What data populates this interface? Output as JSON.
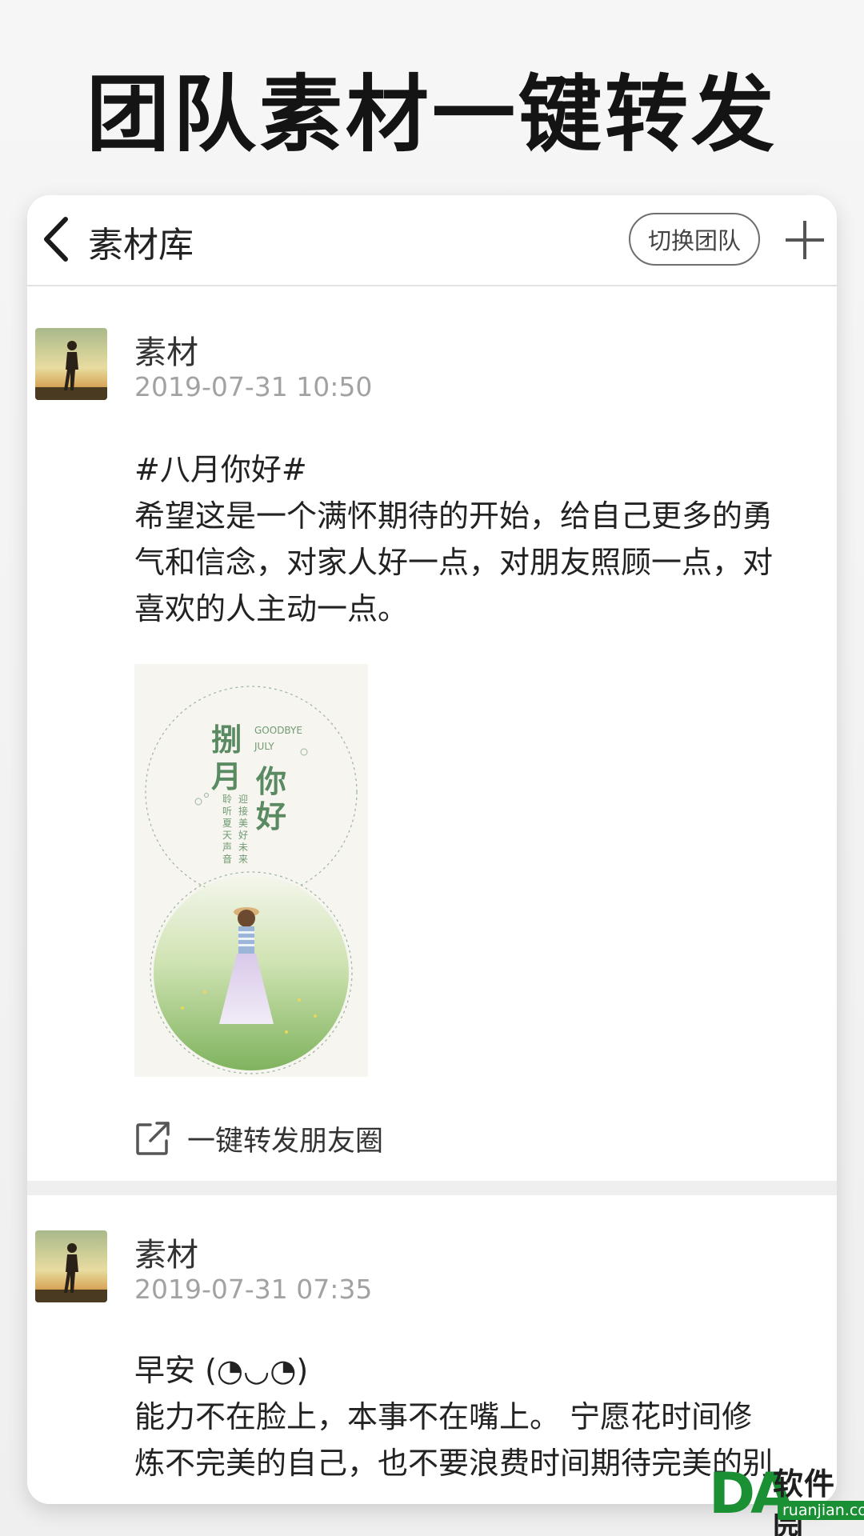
{
  "headline": "团队素材一键转发",
  "navbar": {
    "back_icon": "chevron-left-icon",
    "title": "素材库",
    "switch_team_label": "切换团队",
    "add_icon": "plus-icon"
  },
  "posts": [
    {
      "author": "素材",
      "timestamp": "2019-07-31 10:50",
      "text_lines": [
        "#八月你好#",
        "希望这是一个满怀期待的开始，给自己更多的勇",
        "气和信念，对家人好一点，对朋友照顾一点，对",
        "喜欢的人主动一点。"
      ],
      "image": {
        "title_line1": "捌",
        "title_line2": "月",
        "title_line3": "你",
        "title_line4": "好",
        "en_line1": "GOODBYE",
        "en_line2": "JULY",
        "vertical_left": "聆听夏天声音",
        "vertical_right": "迎接美好未来"
      },
      "share_icon": "external-share-icon",
      "share_label": "一键转发朋友圈"
    },
    {
      "author": "素材",
      "timestamp": "2019-07-31 07:35",
      "text_lines": [
        "早安 (◔◡◔)",
        "能力不在脸上，本事不在嘴上。 宁愿花时间修",
        "炼不完美的自己，也不要浪费时间期待完美的别"
      ]
    }
  ],
  "watermark": {
    "logo": "DA",
    "text": "软件园",
    "domain": "ruanjian.com"
  },
  "colors": {
    "accent_green": "#1a8f34",
    "timestamp_gray": "#a2a2a2",
    "illustration_green": "#5a8a62"
  }
}
